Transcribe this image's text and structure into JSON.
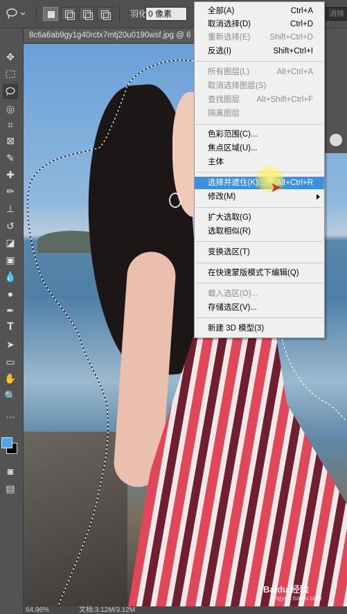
{
  "options_bar": {
    "feather_label": "羽化:",
    "feather_value": "0 像素",
    "right_field": "消除"
  },
  "document": {
    "tab_title": "8c6a6ab9gy1g40rctx7mtj20u0190wsf.jpg @ 6"
  },
  "status": {
    "zoom": "64.96%",
    "doc_info": "文档:3.12M/3.12M"
  },
  "context_menu": {
    "items": [
      {
        "label": "全部(A)",
        "shortcut": "Ctrl+A",
        "disabled": false
      },
      {
        "label": "取消选择(D)",
        "shortcut": "Ctrl+D",
        "disabled": false
      },
      {
        "label": "重新选择(E)",
        "shortcut": "Shift+Ctrl+D",
        "disabled": true
      },
      {
        "label": "反选(I)",
        "shortcut": "Shift+Ctrl+I",
        "disabled": false
      },
      {
        "label": "所有图层(L)",
        "shortcut": "Alt+Ctrl+A",
        "disabled": true
      },
      {
        "label": "取消选择图层(S)",
        "shortcut": "",
        "disabled": true
      },
      {
        "label": "查找图层",
        "shortcut": "Alt+Shift+Ctrl+F",
        "disabled": true
      },
      {
        "label": "隔离图层",
        "shortcut": "",
        "disabled": true
      },
      {
        "label": "色彩范围(C)...",
        "shortcut": "",
        "disabled": false
      },
      {
        "label": "焦点区域(U)...",
        "shortcut": "",
        "disabled": false
      },
      {
        "label": "主体",
        "shortcut": "",
        "disabled": false
      },
      {
        "label": "选择并遮住(K)...",
        "shortcut": "Alt+Ctrl+R",
        "disabled": false,
        "highlighted": true
      },
      {
        "label": "修改(M)",
        "shortcut": "",
        "disabled": false,
        "submenu": true
      },
      {
        "label": "扩大选取(G)",
        "shortcut": "",
        "disabled": false
      },
      {
        "label": "选取相似(R)",
        "shortcut": "",
        "disabled": false
      },
      {
        "label": "变换选区(T)",
        "shortcut": "",
        "disabled": false
      },
      {
        "label": "在快速蒙版模式下编辑(Q)",
        "shortcut": "",
        "disabled": false
      },
      {
        "label": "载入选区(O)...",
        "shortcut": "",
        "disabled": true
      },
      {
        "label": "存储选区(V)...",
        "shortcut": "",
        "disabled": false
      },
      {
        "label": "新建 3D 模型(3)",
        "shortcut": "",
        "disabled": false
      }
    ]
  },
  "tools": [
    "move-tool-icon",
    "marquee-tool-icon",
    "lasso-tool-icon",
    "quick-select-tool-icon",
    "crop-tool-icon",
    "frame-tool-icon",
    "eyedropper-tool-icon",
    "healing-brush-icon",
    "brush-tool-icon",
    "clone-stamp-icon",
    "history-brush-icon",
    "eraser-tool-icon",
    "gradient-tool-icon",
    "blur-tool-icon",
    "dodge-tool-icon",
    "pen-tool-icon",
    "type-tool-icon",
    "path-select-icon",
    "shape-tool-icon",
    "hand-tool-icon",
    "zoom-tool-icon",
    "more-tools-icon"
  ],
  "colors": {
    "foreground": "#51a5ef",
    "background": "#000000",
    "menu_highlight": "#3f8fe0"
  },
  "watermark": {
    "text": "Baidu 经验",
    "subtext": "jingyan.baidu.com"
  }
}
